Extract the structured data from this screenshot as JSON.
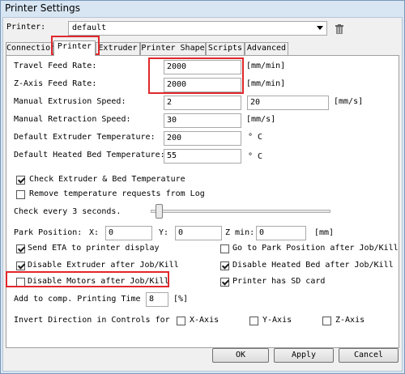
{
  "window": {
    "title": "Printer Settings"
  },
  "printer": {
    "label": "Printer:",
    "selected": "default"
  },
  "tabs": [
    {
      "label": "Connection"
    },
    {
      "label": "Printer"
    },
    {
      "label": "Extruder"
    },
    {
      "label": "Printer Shape"
    },
    {
      "label": "Scripts"
    },
    {
      "label": "Advanced"
    }
  ],
  "fields": {
    "travel_feed": {
      "label": "Travel Feed Rate:",
      "value": "2000",
      "unit": "[mm/min]"
    },
    "zaxis_feed": {
      "label": "Z-Axis Feed Rate:",
      "value": "2000",
      "unit": "[mm/min]"
    },
    "manual_extrusion": {
      "label": "Manual Extrusion Speed:",
      "value1": "2",
      "value2": "20",
      "unit": "[mm/s]"
    },
    "manual_retraction": {
      "label": "Manual Retraction Speed:",
      "value": "30",
      "unit": "[mm/s]"
    },
    "extruder_temp": {
      "label": "Default Extruder Temperature:",
      "value": "200",
      "unit": "° C"
    },
    "bed_temp": {
      "label": "Default Heated Bed Temperature:",
      "value": "55",
      "unit": "° C"
    }
  },
  "checks": {
    "check_temp": {
      "label": "Check Extruder & Bed Temperature",
      "checked": true
    },
    "remove_temp": {
      "label": "Remove temperature requests from Log",
      "checked": false
    },
    "send_eta": {
      "label": "Send ETA to printer display",
      "checked": true
    },
    "go_park": {
      "label": "Go to Park Position after Job/Kill",
      "checked": false
    },
    "disable_extruder": {
      "label": "Disable Extruder after Job/Kill",
      "checked": true
    },
    "disable_bed": {
      "label": "Disable Heated Bed after Job/Kill",
      "checked": true
    },
    "disable_motors": {
      "label": "Disable Motors after Job/Kill",
      "checked": false
    },
    "has_sd": {
      "label": "Printer has SD card",
      "checked": true
    }
  },
  "check_every": {
    "label": "Check every 3 seconds.",
    "slider_fraction": 0.03
  },
  "park": {
    "label": "Park Position:",
    "x_label": "X:",
    "x": "0",
    "y_label": "Y:",
    "y": "0",
    "z_label": "Z min:",
    "z": "0",
    "unit": "[mm]"
  },
  "comp_time": {
    "label": "Add to comp. Printing Time",
    "value": "8",
    "unit": "[%]"
  },
  "invert": {
    "label": "Invert Direction in Controls for",
    "x": "X-Axis",
    "y": "Y-Axis",
    "z": "Z-Axis"
  },
  "buttons": {
    "ok": "OK",
    "apply": "Apply",
    "cancel": "Cancel"
  },
  "colors": {
    "highlight": "#e0282c"
  }
}
